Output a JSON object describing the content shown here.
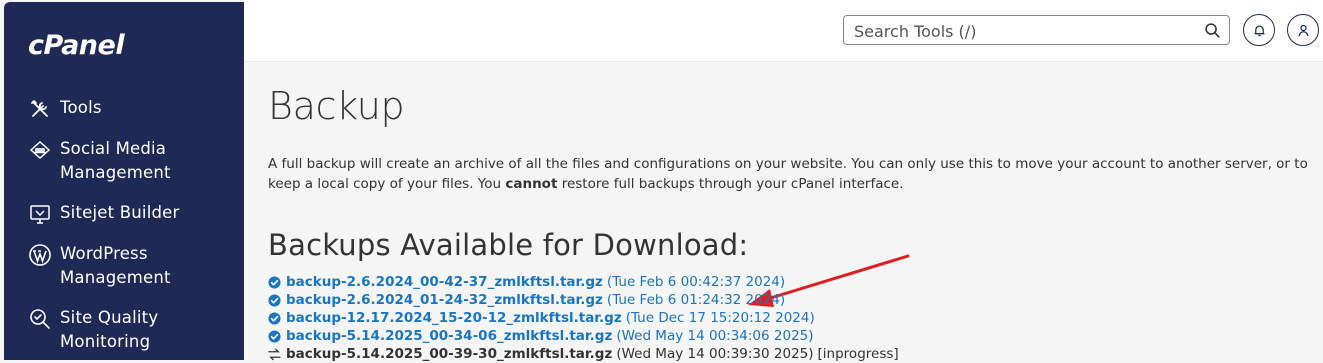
{
  "app": {
    "logo": "cPanel"
  },
  "sidebar": {
    "items": [
      {
        "label": "Tools",
        "icon": "tools-icon"
      },
      {
        "label": "Social Media\nManagement",
        "icon": "social-media-icon"
      },
      {
        "label": "Sitejet Builder",
        "icon": "sitejet-icon"
      },
      {
        "label": "WordPress\nManagement",
        "icon": "wordpress-icon"
      },
      {
        "label": "Site Quality\nMonitoring",
        "icon": "site-quality-icon"
      }
    ]
  },
  "header": {
    "search": {
      "placeholder": "Search Tools (/)",
      "value": ""
    }
  },
  "page": {
    "title": "Backup",
    "description_part1": "A full backup will create an archive of all the files and configurations on your website. You can only use this to move your account to another server, or to keep a local copy of your files. You ",
    "description_bold": "cannot",
    "description_part2": " restore full backups through your cPanel interface.",
    "backups_heading": "Backups Available for Download:",
    "backups": [
      {
        "file": "backup-2.6.2024_00-42-37_zmlkftsl.tar.gz",
        "date": "(Tue Feb 6 00:42:37 2024)",
        "status": "complete",
        "state_label": ""
      },
      {
        "file": "backup-2.6.2024_01-24-32_zmlkftsl.tar.gz",
        "date": "(Tue Feb 6 01:24:32 2024)",
        "status": "complete",
        "state_label": ""
      },
      {
        "file": "backup-12.17.2024_15-20-12_zmlkftsl.tar.gz",
        "date": "(Tue Dec 17 15:20:12 2024)",
        "status": "complete",
        "state_label": ""
      },
      {
        "file": "backup-5.14.2025_00-34-06_zmlkftsl.tar.gz",
        "date": "(Wed May 14 00:34:06 2025)",
        "status": "complete",
        "state_label": ""
      },
      {
        "file": "backup-5.14.2025_00-39-30_zmlkftsl.tar.gz",
        "date": "(Wed May 14 00:39:30 2025)",
        "status": "inprogress",
        "state_label": "[inprogress]"
      }
    ]
  },
  "colors": {
    "sidebar_bg": "#1e2a55",
    "link": "#1976c2",
    "annotation_arrow": "#e02020"
  }
}
